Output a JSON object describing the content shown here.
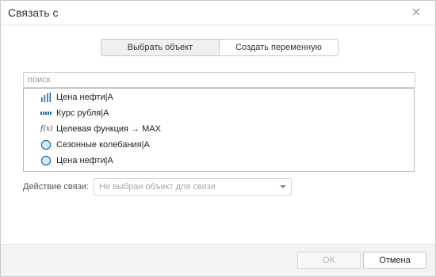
{
  "dialog": {
    "title": "Связать с"
  },
  "mode_toggle": {
    "select_object": "Выбрать объект",
    "create_variable": "Создать переменную"
  },
  "search": {
    "placeholder": "поиск"
  },
  "list": {
    "items": [
      {
        "label": "Цена нефти|A",
        "icon": "bar-chart-icon"
      },
      {
        "label": "Курс рубля|A",
        "icon": "dotted-line-icon"
      },
      {
        "label": "Целевая функция → MAX",
        "icon": "function-icon",
        "icon_text": "f(x)"
      },
      {
        "label": "Сезонные колебания|A",
        "icon": "circle-icon"
      },
      {
        "label": "Цена нефти|A",
        "icon": "circle-icon"
      }
    ]
  },
  "link_action": {
    "label": "Действие связи:",
    "value": "Не выбран объект для связи"
  },
  "footer": {
    "ok": "OK",
    "cancel": "Отмена"
  },
  "colors": {
    "accent": "#1e6fb0",
    "circle_fill": "#d5eaf7"
  }
}
